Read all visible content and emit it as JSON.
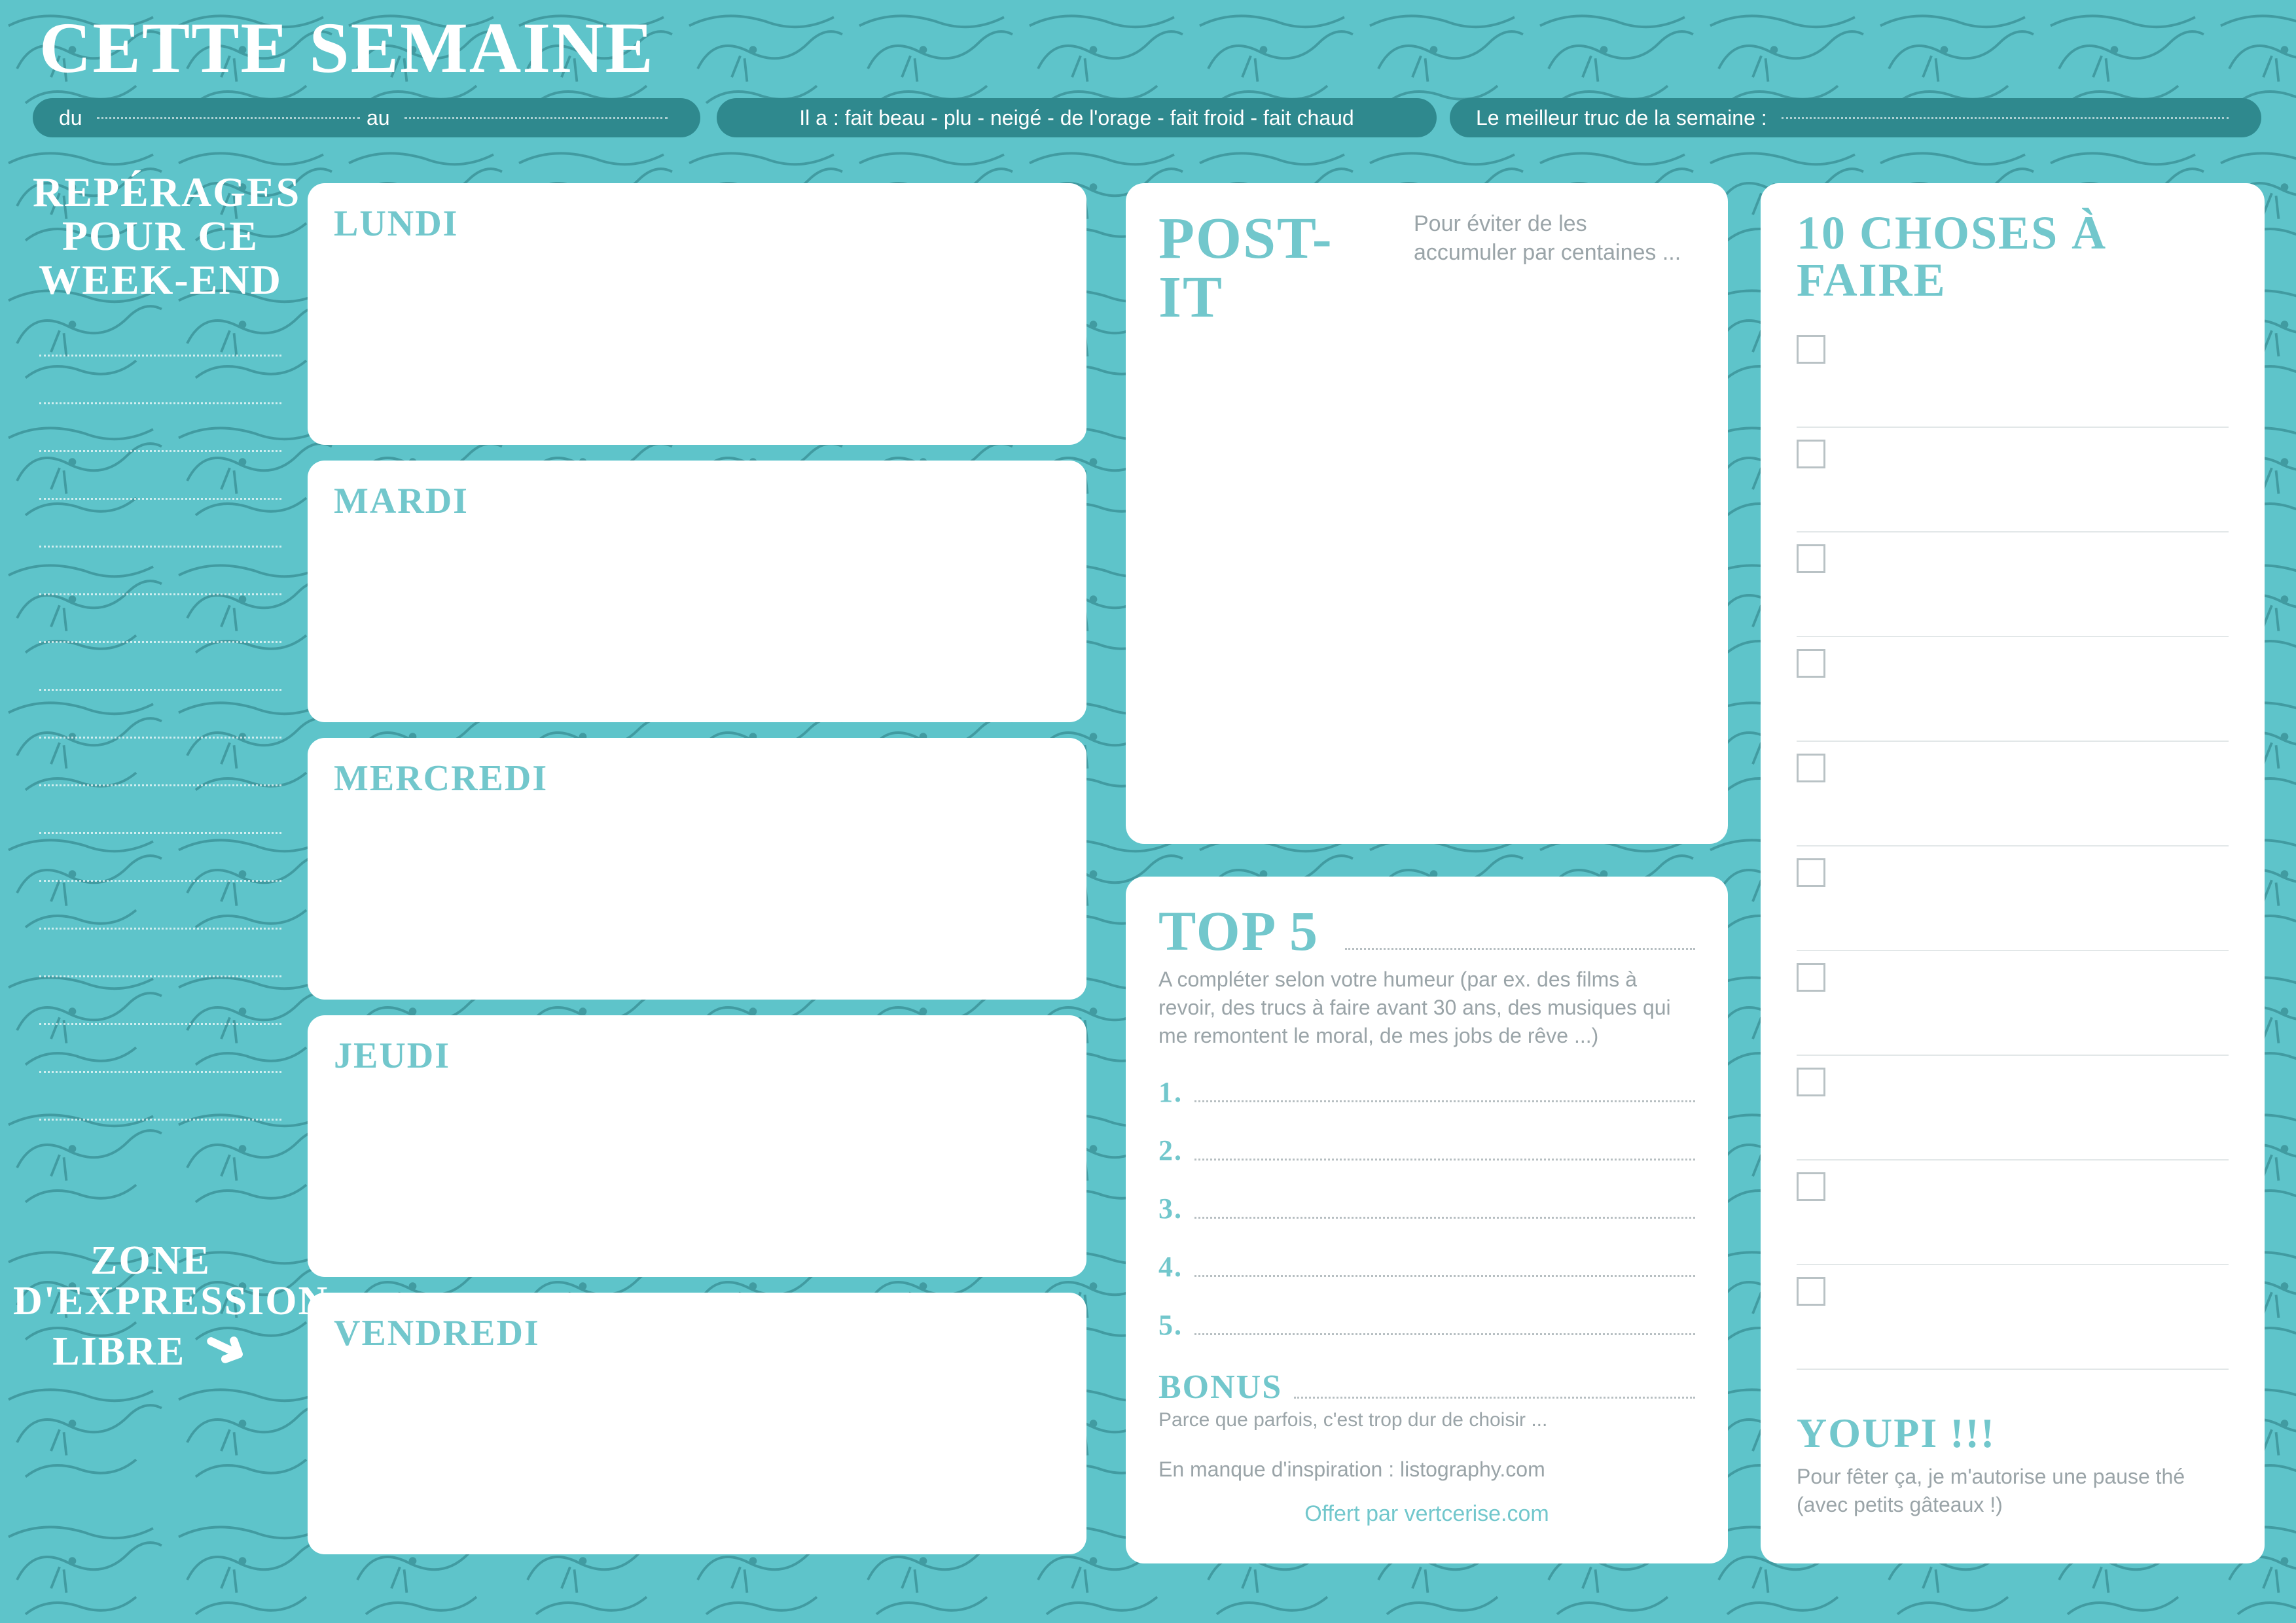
{
  "title": "Cette semaine",
  "date_pill": {
    "from_label": "du",
    "to_label": "au"
  },
  "weather_pill": {
    "text": "Il a : fait beau - plu - neigé - de l'orage - fait froid - fait chaud"
  },
  "best_pill": {
    "label": "Le meilleur truc de la semaine :"
  },
  "sidebar": {
    "title_line1": "Repérages",
    "title_line2": "pour ce",
    "title_line3": "Week-end",
    "footer_line1": "Zone",
    "footer_line2": "d'Expression",
    "footer_line3": "Libre"
  },
  "days": {
    "mon": "Lundi",
    "tue": "Mardi",
    "wed": "Mercredi",
    "thu": "Jeudi",
    "fri": "Vendredi"
  },
  "postit": {
    "title": "Post-it",
    "subtitle": "Pour éviter de les accumuler par centaines ..."
  },
  "top5": {
    "title": "Top 5",
    "desc": "A compléter selon votre humeur (par ex. des films à revoir, des trucs à faire avant 30 ans, des musiques qui me remontent le moral, de mes jobs de rêve ...)",
    "n1": "1.",
    "n2": "2.",
    "n3": "3.",
    "n4": "4.",
    "n5": "5.",
    "bonus_label": "Bonus",
    "bonus_sub": "Parce que parfois, c'est trop dur de choisir ...",
    "inspiration": "En manque d'inspiration : listography.com",
    "credit": "Offert par vertcerise.com"
  },
  "todo": {
    "title": "10 choses à faire",
    "youpi": "Youpi !!!",
    "youpi_sub": "Pour fêter ça, je m'autorise une pause thé (avec petits gâteaux !)"
  }
}
